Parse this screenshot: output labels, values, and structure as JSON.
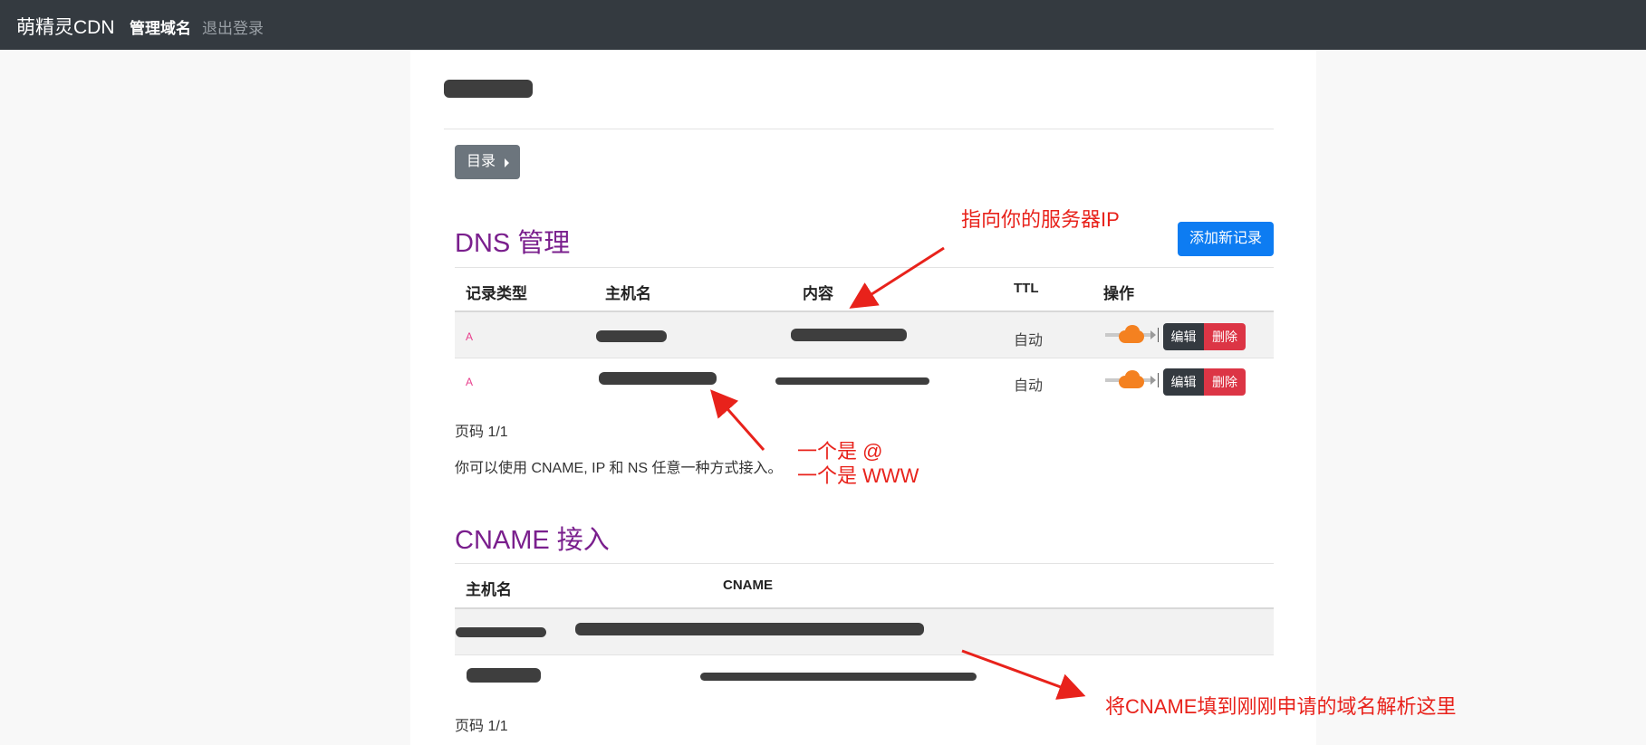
{
  "navbar": {
    "brand": "萌精灵CDN",
    "links": [
      {
        "label": "管理域名",
        "active": true
      },
      {
        "label": "退出登录",
        "active": false
      }
    ]
  },
  "page": {
    "directory_button": "目录"
  },
  "dns": {
    "title": "DNS 管理",
    "add_button": "添加新记录",
    "columns": [
      "记录类型",
      "主机名",
      "内容",
      "TTL",
      "操作"
    ],
    "rows": [
      {
        "type": "A",
        "ttl": "自动",
        "edit": "编辑",
        "delete": "删除"
      },
      {
        "type": "A",
        "ttl": "自动",
        "edit": "编辑",
        "delete": "删除"
      }
    ],
    "pagination": "页码 1/1",
    "note": "你可以使用 CNAME, IP 和 NS 任意一种方式接入。"
  },
  "cname": {
    "title": "CNAME 接入",
    "columns": [
      "主机名",
      "CNAME"
    ],
    "pagination": "页码 1/1"
  },
  "annotations": {
    "server_ip": "指向你的服务器IP",
    "line1": "一个是 @",
    "line2": "一个是 WWW",
    "cname_hint": "将CNAME填到刚刚申请的域名解析这里"
  },
  "colors": {
    "navbar": "#343a40",
    "title": "#7a1f8d",
    "primary": "#0d7cf2",
    "danger": "#dc3545",
    "annotation": "#e8221b",
    "cloud": "#f48120"
  }
}
